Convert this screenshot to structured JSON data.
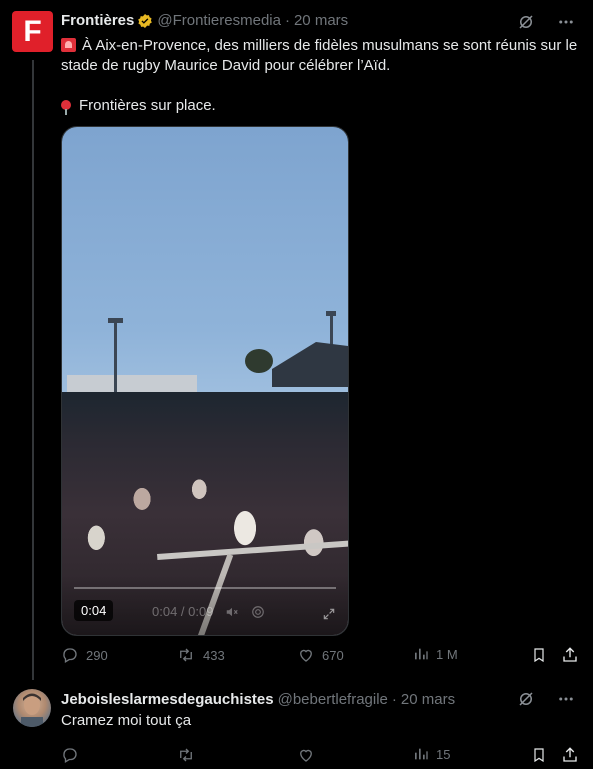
{
  "tweet": {
    "author_name": "Frontières",
    "author_handle": "@Frontieresmedia",
    "separator": "·",
    "date": "20 mars",
    "avatar_letter": "F",
    "text_line1": "À Aix-en-Provence, des milliers de fidèles musulmans se sont réunis sur le stade de rugby Maurice David pour célébrer l’Aïd.",
    "text_line2": "Frontières sur place.",
    "video": {
      "time_badge": "0:04",
      "ghost_time": "0:04 / 0:09"
    },
    "actions": {
      "replies": "290",
      "reposts": "433",
      "likes": "670",
      "views": "1 M"
    }
  },
  "reply": {
    "author_name": "Jeboisleslarmesdegauchistes",
    "author_handle": "@bebertlefragile",
    "separator": "·",
    "date": "20 mars",
    "text": "Cramez moi tout ça",
    "actions": {
      "replies": "",
      "reposts": "",
      "likes": "",
      "views": "15"
    }
  },
  "colors": {
    "background": "#000000",
    "text": "#e7e9ea",
    "muted": "#71767b",
    "brand_red": "#e0202a",
    "verified_gold": "#e8b923"
  },
  "icons": [
    "grok-icon",
    "more-icon",
    "reply-icon",
    "repost-icon",
    "like-icon",
    "views-icon",
    "bookmark-icon",
    "share-icon",
    "verified-icon",
    "expand-icon"
  ]
}
